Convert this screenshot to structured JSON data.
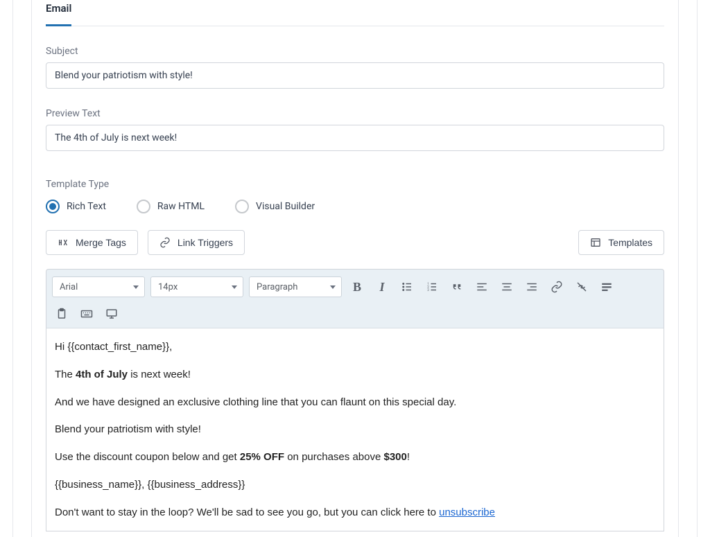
{
  "tab": {
    "label": "Email"
  },
  "subject": {
    "label": "Subject",
    "value": "Blend your patriotism with style!"
  },
  "preview": {
    "label": "Preview Text",
    "value": "The 4th of July is next week!"
  },
  "template_type": {
    "label": "Template Type",
    "options": {
      "rich_text": "Rich Text",
      "raw_html": "Raw HTML",
      "visual_builder": "Visual Builder"
    },
    "selected": "rich_text"
  },
  "buttons": {
    "merge_tags": "Merge Tags",
    "link_triggers": "Link Triggers",
    "templates": "Templates"
  },
  "editor": {
    "font": "Arial",
    "size": "14px",
    "format": "Paragraph"
  },
  "content": {
    "greeting_pre": "Hi ",
    "greeting_var": "{{contact_first_name}}",
    "greeting_post": ",",
    "line2_pre": "The ",
    "line2_bold": "4th of July",
    "line2_post": " is next week!",
    "line3": "And we have designed an exclusive clothing line that you can flaunt on this special day.",
    "line4": "Blend your patriotism with style!",
    "line5_a": "Use the discount coupon below and get ",
    "line5_bold1": "25% OFF",
    "line5_b": " on purchases above ",
    "line5_bold2": "$300",
    "line5_c": "!",
    "line6_a": "{{business_name}}",
    "line6_b": ", ",
    "line6_c": "{{business_address}}",
    "line7_a": "Don't want to stay in the loop? We'll be sad to see you go, but you can click here to ",
    "line7_link": "unsubscribe"
  }
}
